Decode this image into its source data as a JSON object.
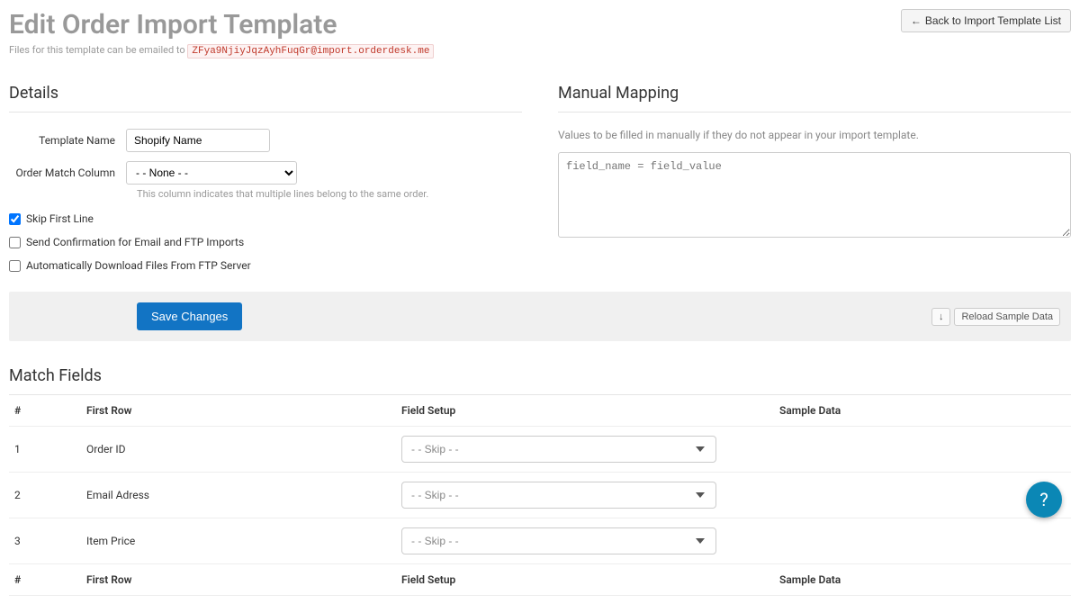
{
  "header": {
    "title": "Edit Order Import Template",
    "subtitle_prefix": "Files for this template can be emailed to ",
    "email_code": "ZFya9NjiyJqzAyhFuqGr@import.orderdesk.me",
    "back_button": "Back to Import Template List"
  },
  "details": {
    "title": "Details",
    "template_name_label": "Template Name",
    "template_name_value": "Shopify Name",
    "order_match_label": "Order Match Column",
    "order_match_value": "- - None - -",
    "order_match_hint": "This column indicates that multiple lines belong to the same order.",
    "skip_first_line_label": "Skip First Line",
    "send_confirmation_label": "Send Confirmation for Email and FTP Imports",
    "auto_download_label": "Automatically Download Files From FTP Server"
  },
  "mapping": {
    "title": "Manual Mapping",
    "hint": "Values to be filled in manually if they do not appear in your import template.",
    "placeholder": "field_name = field_value"
  },
  "actions": {
    "save": "Save Changes",
    "reload": "Reload Sample Data"
  },
  "match_fields": {
    "title": "Match Fields",
    "columns": {
      "num": "#",
      "first_row": "First Row",
      "field_setup": "Field Setup",
      "sample_data": "Sample Data"
    },
    "rows": [
      {
        "num": "1",
        "first_row": "Order ID",
        "field_setup": "- - Skip - -",
        "sample": ""
      },
      {
        "num": "2",
        "first_row": "Email Adress",
        "field_setup": "- - Skip - -",
        "sample": ""
      },
      {
        "num": "3",
        "first_row": "Item Price",
        "field_setup": "- - Skip - -",
        "sample": ""
      }
    ]
  },
  "help": {
    "label": "?"
  }
}
